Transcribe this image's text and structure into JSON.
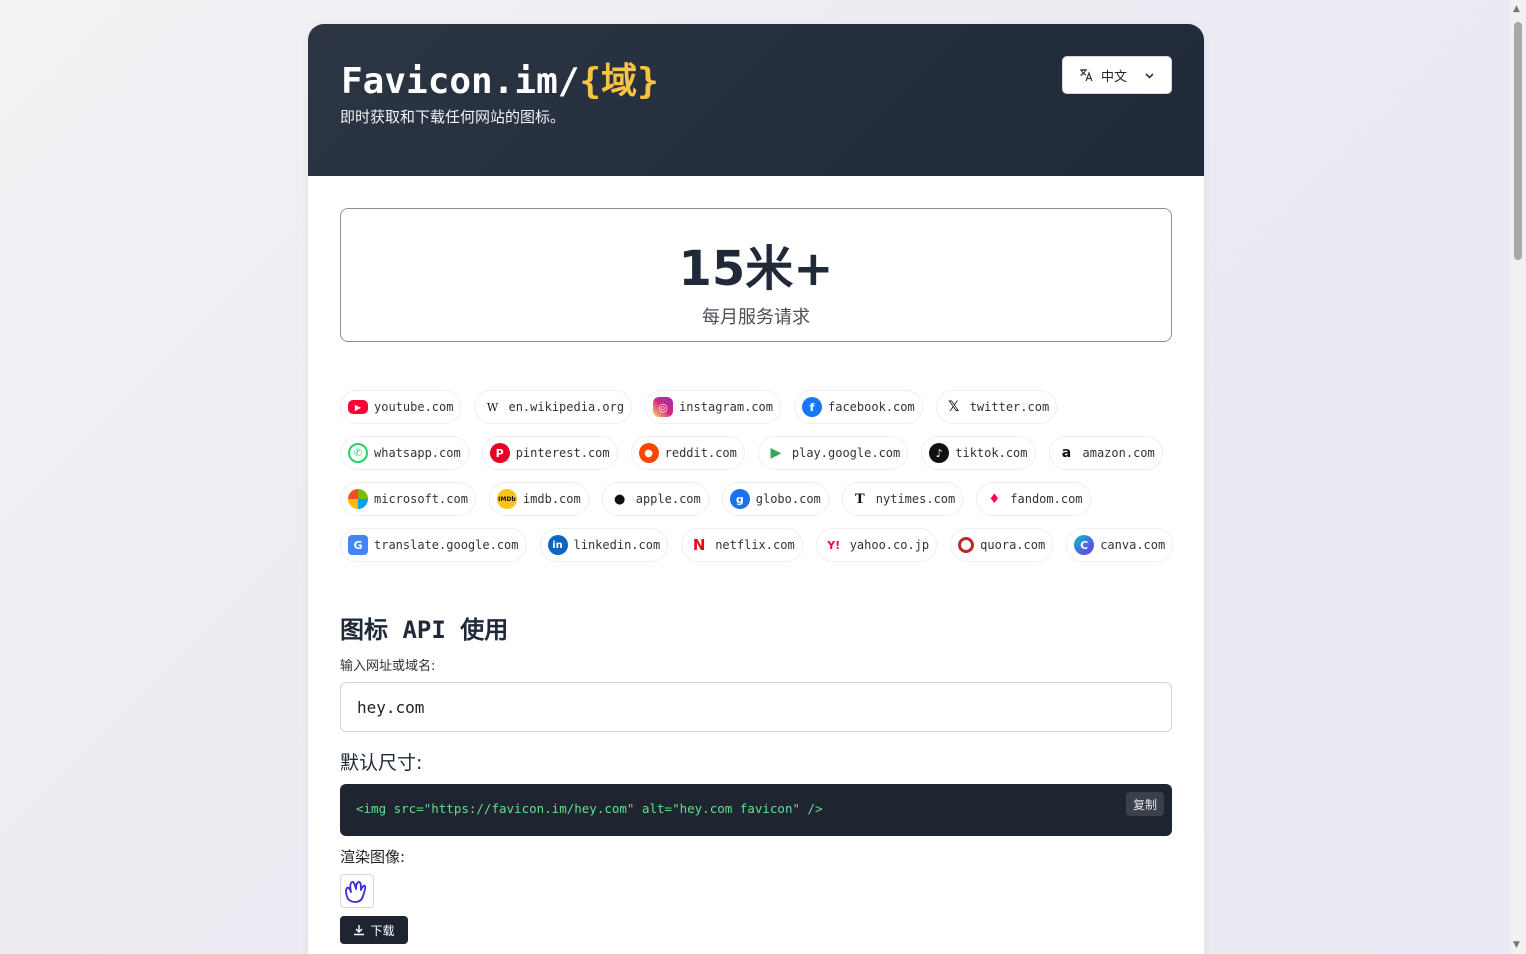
{
  "header": {
    "brand_prefix": "Favicon.im/",
    "brand_accent": "{域}",
    "tagline": "即时获取和下载任何网站的图标。",
    "language": "中文"
  },
  "stat": {
    "value": "15米+",
    "caption": "每月服务请求"
  },
  "sites": [
    [
      "youtube.com",
      "en.wikipedia.org",
      "instagram.com",
      "facebook.com",
      "twitter.com"
    ],
    [
      "whatsapp.com",
      "pinterest.com",
      "reddit.com",
      "play.google.com",
      "tiktok.com",
      "amazon.com"
    ],
    [
      "microsoft.com",
      "imdb.com",
      "apple.com",
      "globo.com",
      "nytimes.com",
      "fandom.com"
    ],
    [
      "translate.google.com",
      "linkedin.com",
      "netflix.com",
      "yahoo.co.jp",
      "quora.com",
      "canva.com"
    ]
  ],
  "api": {
    "title": "图标 API 使用",
    "input_label": "输入网址或域名:",
    "input_value": "hey.com",
    "default_size_label": "默认尺寸:",
    "code": "<img src=\"https://favicon.im/hey.com\" alt=\"hey.com favicon\" />",
    "copy_label": "复制",
    "render_label": "渲染图像:",
    "download_label": "下载"
  },
  "icons": {
    "language": "translate-icon",
    "dropdown": "chevron-down-icon",
    "download": "download-icon",
    "preview": "hey-hand-icon"
  }
}
